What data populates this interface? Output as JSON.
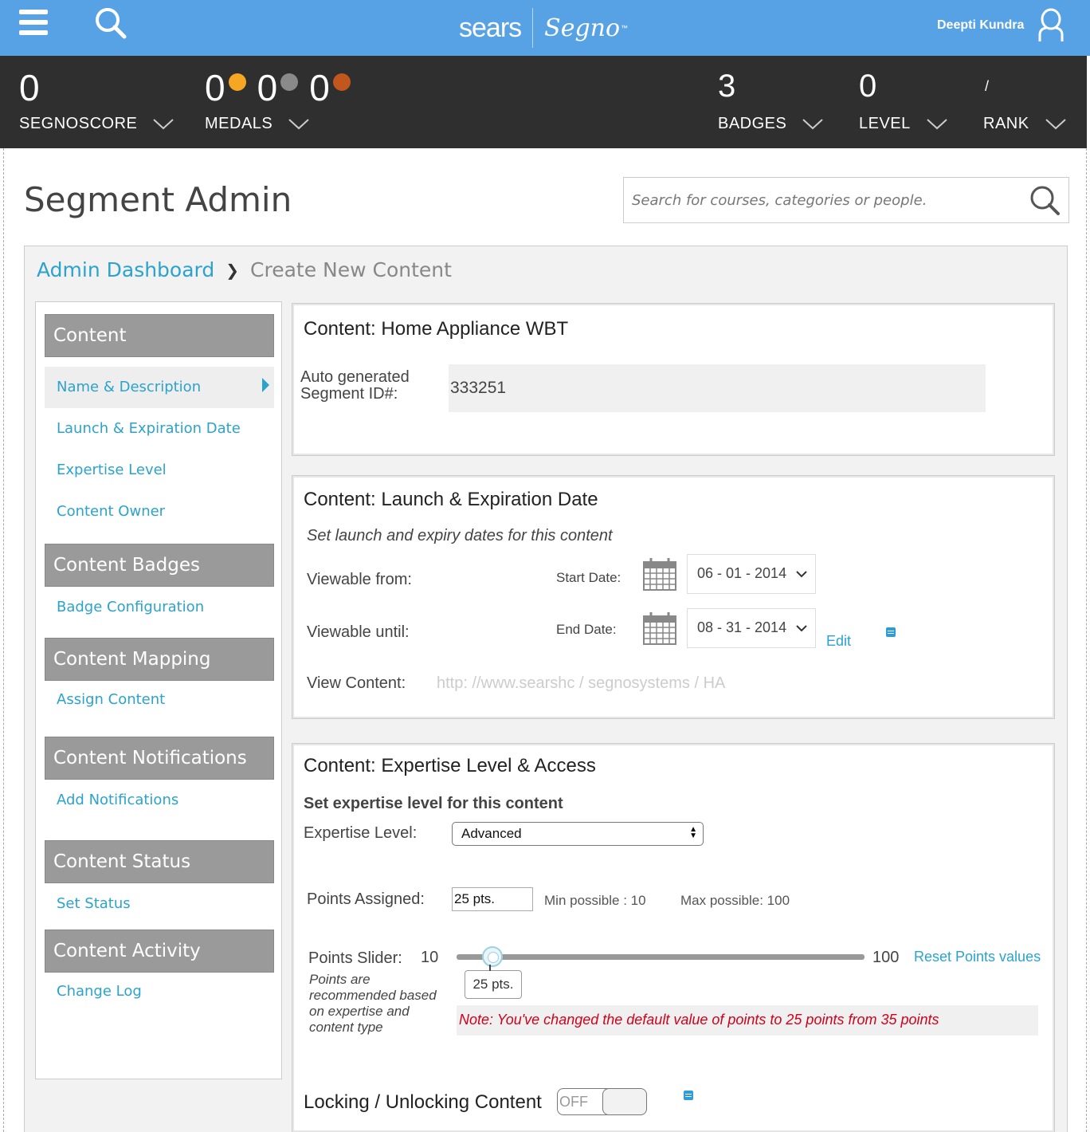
{
  "header": {
    "brand_sears": "sears",
    "brand_segno": "Segno",
    "brand_tm": "™",
    "user_name": "Deepti Kundra"
  },
  "stats": {
    "segnoscore": {
      "value": "0",
      "label": "SEGNOSCORE"
    },
    "medals": {
      "label": "MEDALS",
      "gold": "0",
      "silver": "0",
      "bronze": "0",
      "colors": {
        "gold": "#f5a623",
        "silver": "#8a8a8a",
        "bronze": "#c1571c"
      }
    },
    "badges": {
      "value": "3",
      "label": "BADGES"
    },
    "level": {
      "value": "0",
      "label": "LEVEL"
    },
    "rank": {
      "value": "/",
      "label": "RANK"
    }
  },
  "page": {
    "title": "Segment Admin",
    "search_placeholder": "Search for courses, categories or people."
  },
  "breadcrumb": {
    "link": "Admin Dashboard",
    "separator": "❯",
    "current": "Create New Content"
  },
  "sidebar": {
    "sections": [
      {
        "title": "Content",
        "items": [
          "Name & Description",
          "Launch & Expiration Date",
          "Expertise Level",
          "Content Owner"
        ]
      },
      {
        "title": "Content Badges",
        "items": [
          "Badge Configuration"
        ]
      },
      {
        "title": "Content Mapping",
        "items": [
          "Assign Content"
        ]
      },
      {
        "title": "Content Notifications",
        "items": [
          "Add Notifications"
        ]
      },
      {
        "title": "Content Status",
        "items": [
          "Set Status"
        ]
      },
      {
        "title": "Content Activity",
        "items": [
          "Change Log"
        ]
      }
    ],
    "active_item": "Name & Description"
  },
  "card_name": {
    "title": "Content: Home Appliance WBT",
    "id_label_1": "Auto generated",
    "id_label_2": "Segment ID#:",
    "id_value": "333251"
  },
  "card_dates": {
    "title": "Content: Launch & Expiration Date",
    "subtitle": "Set launch and expiry dates for this content",
    "viewable_from": "Viewable from:",
    "start_label": "Start Date:",
    "start_value": "06 - 01 - 2014",
    "viewable_until": "Viewable until:",
    "end_label": "End Date:",
    "end_value": "08 - 31 - 2014",
    "edit": "Edit",
    "view_content_label": "View Content:",
    "view_content_url": "http: //www.searshc / segnosystems / HA"
  },
  "card_expertise": {
    "title": "Content: Expertise Level & Access",
    "subtitle": "Set expertise level for this content",
    "level_label": "Expertise Level:",
    "level_value": "Advanced",
    "points_label": "Points Assigned:",
    "points_value": "25 pts.",
    "min_possible": "Min possible : 10",
    "max_possible": "Max possible: 100",
    "slider_label": "Points Slider:",
    "slider_min": "10",
    "slider_max": "100",
    "slider_value_text": "25 pts.",
    "slider_value": 25,
    "reset": "Reset Points values",
    "slider_help_1": "Points are",
    "slider_help_2": "recommended based",
    "slider_help_3": "on expertise and",
    "slider_help_4": "content type",
    "note": "Note: You've changed the default value of points to 25 points  from 35 points",
    "locking_label": "Locking / Unlocking Content",
    "toggle_text": "OFF"
  },
  "colors": {
    "topbar": "#57a1e5",
    "statsbar": "#2f2f2f",
    "accent_link": "#2ba3cc",
    "sidebar_head": "#9a9a9a",
    "note_text": "#d0021b"
  }
}
